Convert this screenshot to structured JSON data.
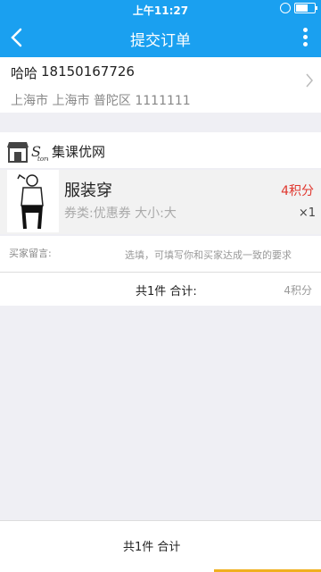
{
  "status_bar": {
    "time": "上午11:27"
  },
  "nav": {
    "title": "提交订单"
  },
  "address": {
    "name": "哈哈",
    "phone": "18150167726",
    "line2": "上海市 上海市 普陀区 1111111"
  },
  "store": {
    "name": "集课优网"
  },
  "product": {
    "name": "服装穿",
    "info": "券类:优惠券 大小:大",
    "points": "4积分",
    "qty": "×1"
  },
  "message": {
    "label": "买家留言:",
    "placeholder": "选填，可填写你和买家达成一致的要求"
  },
  "summary": {
    "text": "共1件 合计:",
    "value": "4积分"
  },
  "footer": {
    "text": "共1件 合计"
  }
}
